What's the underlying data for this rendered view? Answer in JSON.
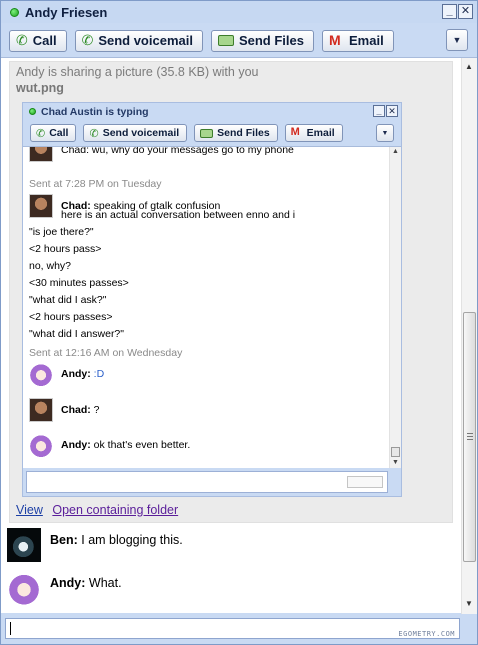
{
  "window": {
    "title": "Andy Friesen"
  },
  "toolbar": {
    "call_label": "Call",
    "voicemail_label": "Send voicemail",
    "files_label": "Send Files",
    "email_label": "Email",
    "menu_glyph": "▼"
  },
  "share": {
    "line1": "Andy is sharing a picture (35.8 KB) with you",
    "filename": "wut.png",
    "view_link": "View",
    "open_folder_link": "Open containing folder"
  },
  "picture": {
    "title": "Chad Austin is typing",
    "toolbar": {
      "call_label": "Call",
      "voicemail_label": "Send voicemail",
      "files_label": "Send Files",
      "email_label": "Email"
    },
    "cut_line": "Chad: wu, why do your messages go to my phone",
    "sent1": "Sent at 7:28 PM on Tuesday",
    "chad_name": "Chad:",
    "chad_msg": "speaking of gtalk confusion",
    "lines": [
      "here is an actual conversation between enno and i",
      "\"is joe there?\"",
      "<2 hours pass>",
      "no, why?",
      "<30 minutes passes>",
      "\"what did I ask?\"",
      "<2 hours passes>",
      "\"what did I answer?\""
    ],
    "sent2": "Sent at 12:16 AM on Wednesday",
    "andy_name": "Andy:",
    "andy_msg1": ":D",
    "chad_name2": "Chad:",
    "chad_msg2": "?",
    "andy_name2": "Andy:",
    "andy_msg2": "ok that's even better."
  },
  "messages": [
    {
      "name": "Ben:",
      "text": "I am blogging this."
    },
    {
      "name": "Andy:",
      "text": "What."
    }
  ],
  "watermark": "EGOMETRY.COM"
}
